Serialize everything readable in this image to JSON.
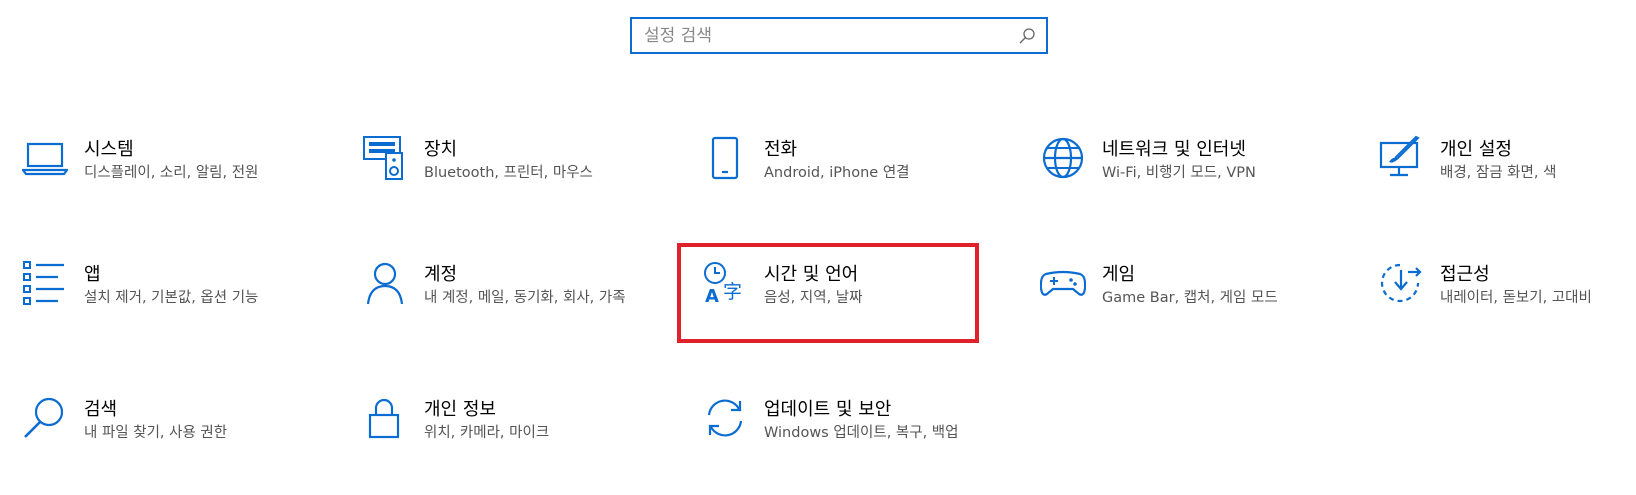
{
  "search": {
    "placeholder": "설정 검색"
  },
  "tiles": [
    {
      "title": "시스템",
      "desc": "디스플레이, 소리, 알림, 전원",
      "icon": "laptop-icon"
    },
    {
      "title": "장치",
      "desc": "Bluetooth, 프린터, 마우스",
      "icon": "devices-icon"
    },
    {
      "title": "전화",
      "desc": "Android, iPhone 연결",
      "icon": "phone-icon"
    },
    {
      "title": "네트워크 및 인터넷",
      "desc": "Wi-Fi, 비행기 모드, VPN",
      "icon": "globe-icon"
    },
    {
      "title": "개인 설정",
      "desc": "배경, 잠금 화면, 색",
      "icon": "personalization-icon"
    },
    {
      "title": "앱",
      "desc": "설치 제거, 기본값, 옵션 기능",
      "icon": "apps-list-icon"
    },
    {
      "title": "계정",
      "desc": "내 계정, 메일, 동기화, 회사, 가족",
      "icon": "person-icon"
    },
    {
      "title": "시간 및 언어",
      "desc": "음성, 지역, 날짜",
      "icon": "time-language-icon"
    },
    {
      "title": "게임",
      "desc": "Game Bar, 캡처, 게임 모드",
      "icon": "gamepad-icon"
    },
    {
      "title": "접근성",
      "desc": "내레이터, 돋보기, 고대비",
      "icon": "accessibility-icon"
    },
    {
      "title": "검색",
      "desc": "내 파일 찾기, 사용 권한",
      "icon": "search-icon"
    },
    {
      "title": "개인 정보",
      "desc": "위치, 카메라, 마이크",
      "icon": "lock-icon"
    },
    {
      "title": "업데이트 및 보안",
      "desc": "Windows 업데이트, 복구, 백업",
      "icon": "update-icon"
    }
  ],
  "colors": {
    "accent": "#0b6cd1",
    "highlight": "#e0202a"
  }
}
